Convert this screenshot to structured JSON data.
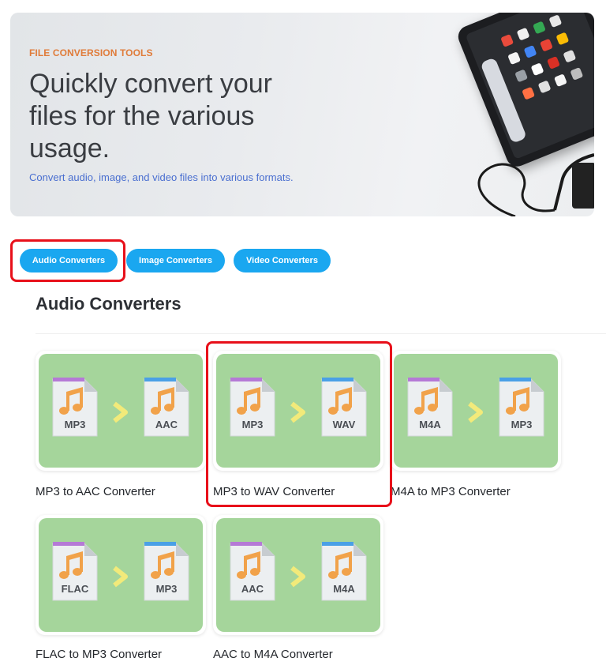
{
  "hero": {
    "eyebrow": "FILE CONVERSION TOOLS",
    "headline": "Quickly convert your files for the various usage.",
    "subline": "Convert audio, image, and video files into various formats."
  },
  "tabs": [
    {
      "label": "Audio Converters",
      "selected": true
    },
    {
      "label": "Image Converters",
      "selected": false
    },
    {
      "label": "Video Converters",
      "selected": false
    }
  ],
  "section": {
    "title": "Audio Converters"
  },
  "converters": [
    {
      "label": "MP3 to AAC Converter",
      "from": "MP3",
      "to": "AAC"
    },
    {
      "label": "MP3 to WAV Converter",
      "from": "MP3",
      "to": "WAV"
    },
    {
      "label": "M4A to MP3 Converter",
      "from": "M4A",
      "to": "MP3"
    },
    {
      "label": "FLAC to MP3 Converter",
      "from": "FLAC",
      "to": "MP3"
    },
    {
      "label": "AAC to M4A Converter",
      "from": "AAC",
      "to": "M4A"
    }
  ],
  "colors": {
    "accent": "#1aa7f0",
    "highlight": "#e8101a",
    "card_bg": "#a5d59b",
    "eyebrow": "#e07b39",
    "source_file_tab": "#b57ad6",
    "target_file_tab": "#4aa0e6",
    "note_icon": "#f1a24a",
    "arrow": "#f2ea7a"
  }
}
